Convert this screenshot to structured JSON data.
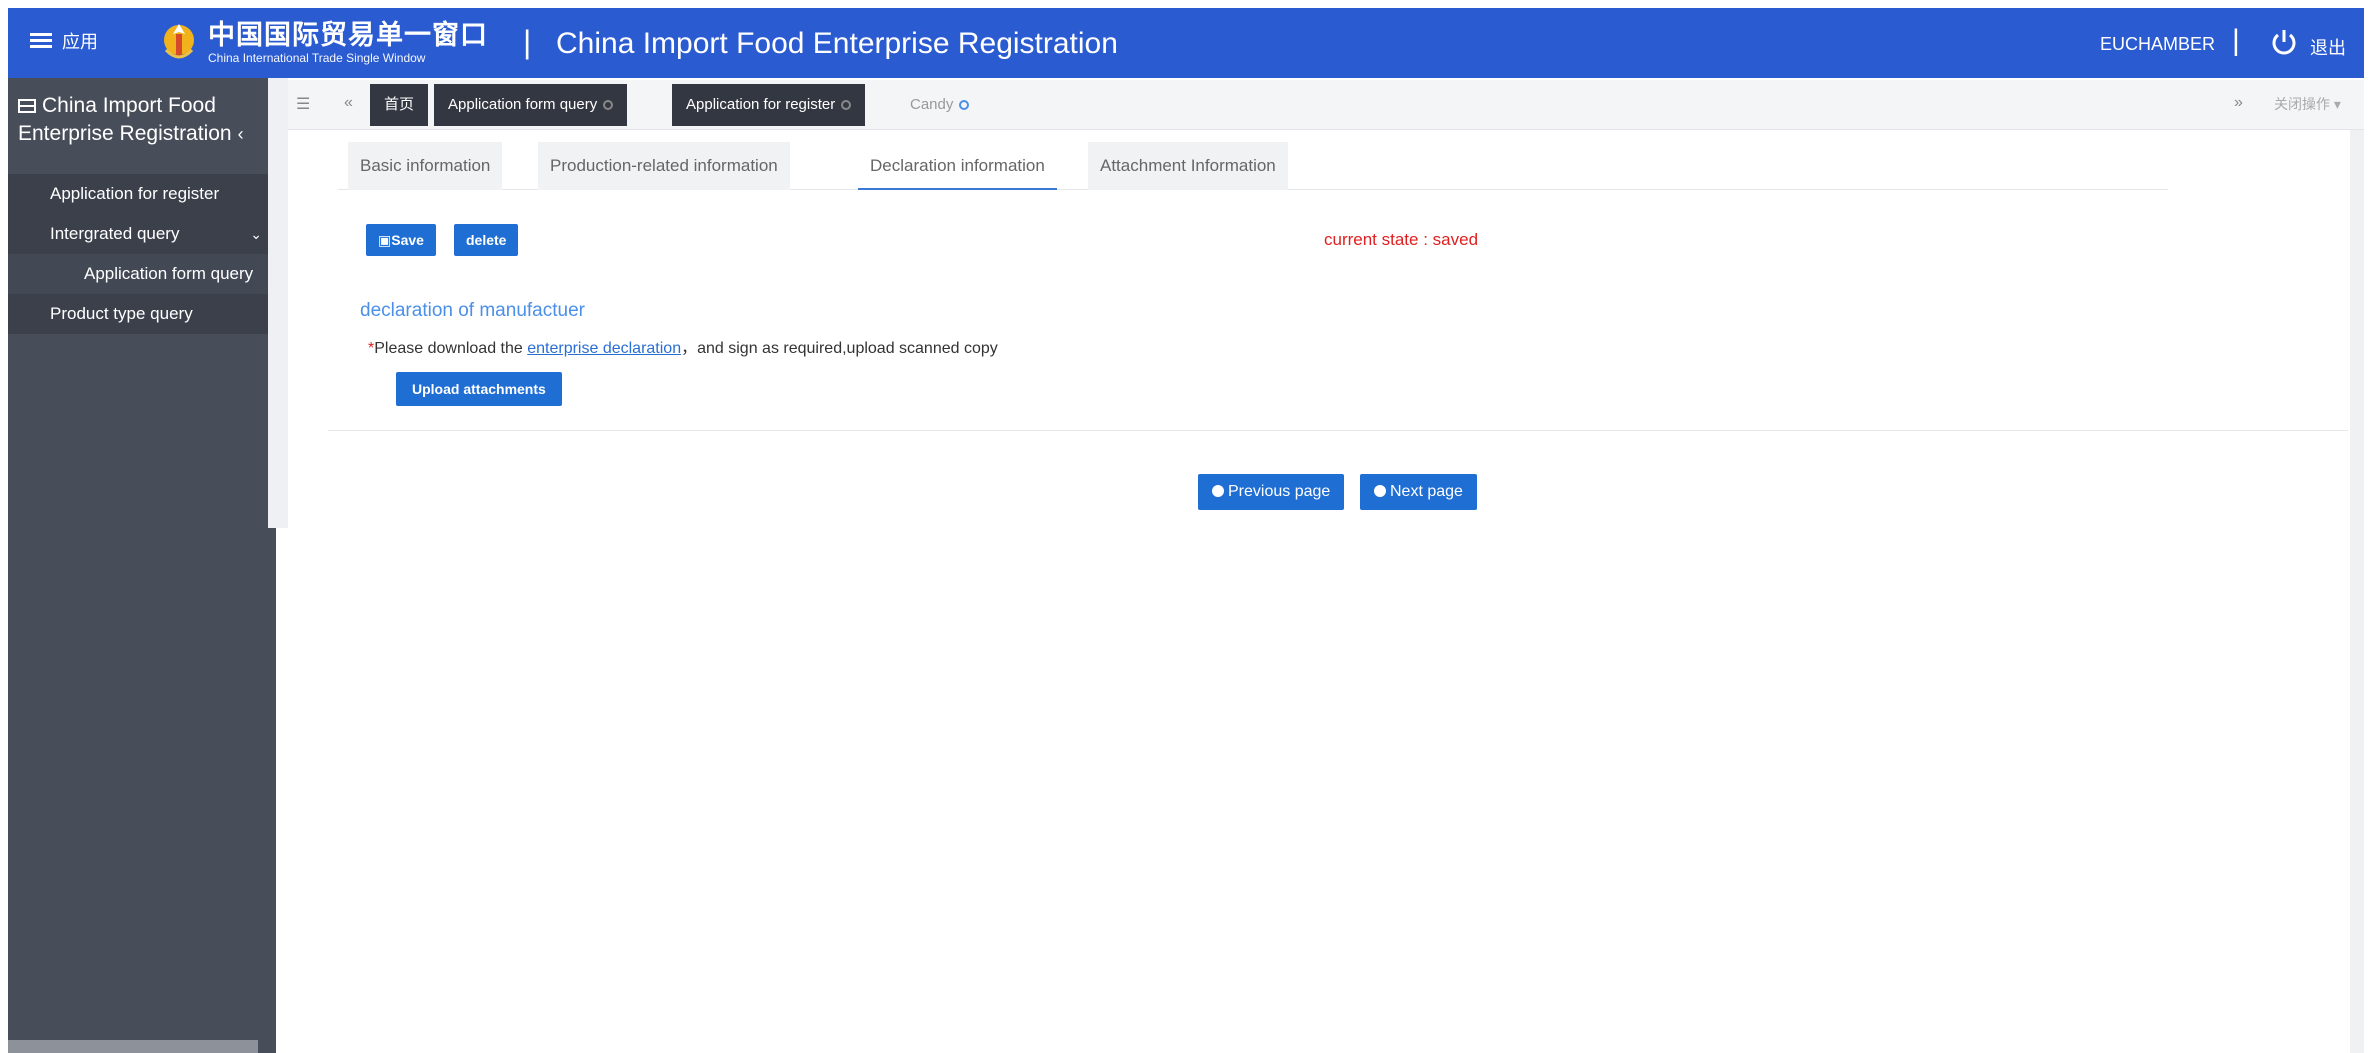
{
  "header": {
    "menu_label": "应用",
    "brand_cn": "中国国际贸易单一窗口",
    "brand_en": "China International Trade Single Window",
    "app_title": "China Import Food Enterprise Registration",
    "user": "EUCHAMBER",
    "logout": "退出",
    "bg_color": "#2b5bd1"
  },
  "sidebar": {
    "title": "China Import Food Enterprise Registration",
    "items": [
      {
        "label": "Application for register"
      },
      {
        "label": "Intergrated query"
      },
      {
        "label": "Application form query"
      },
      {
        "label": "Product type query"
      }
    ]
  },
  "page_tabs": {
    "tabs": [
      {
        "label": "首页"
      },
      {
        "label": "Application form query"
      },
      {
        "label": "Application for register"
      },
      {
        "label": "Candy"
      }
    ],
    "close_ops": "关闭操作"
  },
  "form_tabs": [
    {
      "label": "Basic information"
    },
    {
      "label": "Production-related information"
    },
    {
      "label": "Declaration information"
    },
    {
      "label": "Attachment Information"
    }
  ],
  "actions": {
    "save": "Save",
    "delete": "delete",
    "current_state": "current state : saved"
  },
  "declaration": {
    "title": "declaration of manufactuer",
    "required_mark": "*",
    "text_before": "Please download the ",
    "link": "enterprise declaration",
    "text_after": "，and sign as required,upload scanned copy",
    "upload": "Upload attachments"
  },
  "nav": {
    "previous": "Previous page",
    "next": "Next page"
  }
}
